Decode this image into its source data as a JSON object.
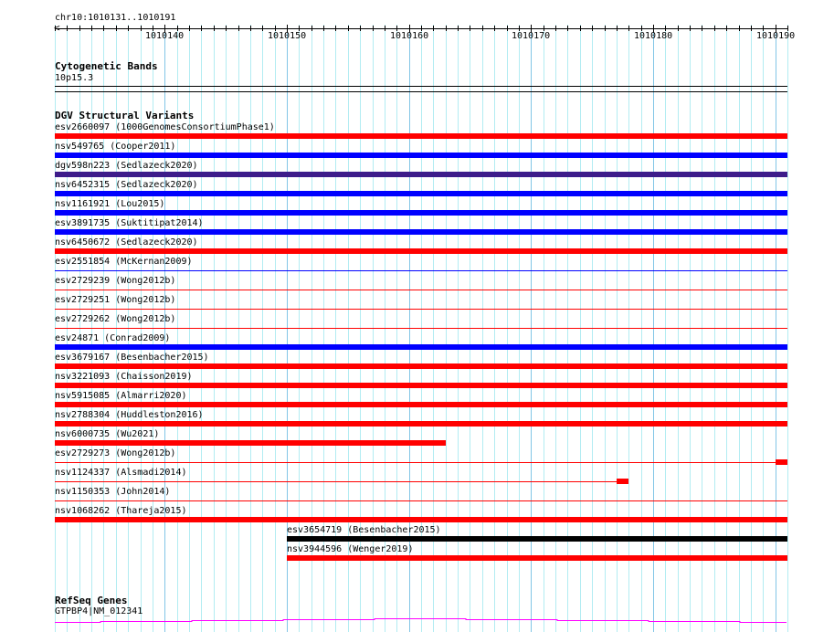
{
  "ruler": {
    "location": "chr10:1010131..1010191",
    "start": 1010131,
    "end": 1010191,
    "tick_labels": [
      "1010140",
      "1010150",
      "1010160",
      "1010170",
      "1010180",
      "1010190"
    ]
  },
  "cytoband": {
    "title": "Cytogenetic Bands",
    "band": "10p15.3"
  },
  "dgv": {
    "title": "DGV Structural Variants",
    "colors": {
      "red": "#ff0000",
      "blue": "#0000ff",
      "purple": "#3d1c8a",
      "black": "#000000"
    },
    "rows": [
      {
        "label": "esv2660097 (1000GenomesConsortiumPhase1)",
        "color": "#ff0000",
        "style": "bar",
        "start": 1010131,
        "end": 1010191
      },
      {
        "label": "nsv549765 (Cooper2011)",
        "color": "#0000ff",
        "style": "bar",
        "start": 1010131,
        "end": 1010191
      },
      {
        "label": "dgv598n223 (Sedlazeck2020)",
        "color": "#3d1c8a",
        "style": "bar",
        "start": 1010131,
        "end": 1010191
      },
      {
        "label": "nsv6452315 (Sedlazeck2020)",
        "color": "#0000ff",
        "style": "bar",
        "start": 1010131,
        "end": 1010191
      },
      {
        "label": "nsv1161921 (Lou2015)",
        "color": "#0000ff",
        "style": "bar",
        "start": 1010131,
        "end": 1010191
      },
      {
        "label": "esv3891735 (Suktitipat2014)",
        "color": "#0000ff",
        "style": "bar",
        "start": 1010131,
        "end": 1010191
      },
      {
        "label": "nsv6450672 (Sedlazeck2020)",
        "color": "#ff0000",
        "style": "bar",
        "start": 1010131,
        "end": 1010191
      },
      {
        "label": "esv2551854 (McKernan2009)",
        "color": "#0000ff",
        "style": "line",
        "start": 1010131,
        "end": 1010191
      },
      {
        "label": "esv2729239 (Wong2012b)",
        "color": "#ff0000",
        "style": "line",
        "start": 1010131,
        "end": 1010191
      },
      {
        "label": "esv2729251 (Wong2012b)",
        "color": "#ff0000",
        "style": "line",
        "start": 1010131,
        "end": 1010191
      },
      {
        "label": "esv2729262 (Wong2012b)",
        "color": "#ff0000",
        "style": "line",
        "start": 1010131,
        "end": 1010191
      },
      {
        "label": "esv24871 (Conrad2009)",
        "color": "#0000ff",
        "style": "bar",
        "start": 1010131,
        "end": 1010191
      },
      {
        "label": "esv3679167 (Besenbacher2015)",
        "color": "#ff0000",
        "style": "bar",
        "start": 1010131,
        "end": 1010191
      },
      {
        "label": "nsv3221093 (Chaisson2019)",
        "color": "#ff0000",
        "style": "bar",
        "start": 1010131,
        "end": 1010191
      },
      {
        "label": "nsv5915085 (Almarri2020)",
        "color": "#ff0000",
        "style": "bar",
        "start": 1010131,
        "end": 1010191
      },
      {
        "label": "nsv2788304 (Huddleston2016)",
        "color": "#ff0000",
        "style": "bar",
        "start": 1010131,
        "end": 1010191
      },
      {
        "label": "nsv6000735 (Wu2021)",
        "color": "#ff0000",
        "style": "bar",
        "start": 1010131,
        "end": 1010163
      },
      {
        "label": "esv2729273 (Wong2012b)",
        "color": "#ff0000",
        "style": "line",
        "start": 1010131,
        "end": 1010190,
        "block": [
          1010190,
          1010191
        ]
      },
      {
        "label": "nsv1124337 (Alsmadi2014)",
        "color": "#ff0000",
        "style": "line",
        "start": 1010131,
        "end": 1010177,
        "block": [
          1010177,
          1010178
        ]
      },
      {
        "label": "nsv1150353 (John2014)",
        "color": "#ff0000",
        "style": "line",
        "start": 1010131,
        "end": 1010191
      },
      {
        "label": "nsv1068262 (Thareja2015)",
        "color": "#ff0000",
        "style": "bar",
        "start": 1010131,
        "end": 1010191
      },
      {
        "label": "esv3654719 (Besenbacher2015)",
        "color": "#000000",
        "style": "bar",
        "start": 1010150,
        "end": 1010191
      },
      {
        "label": "nsv3944596 (Wenger2019)",
        "color": "#ff0000",
        "style": "bar",
        "start": 1010150,
        "end": 1010191
      }
    ]
  },
  "refseq": {
    "title": "RefSeq Genes",
    "gene": "GTPBP4|NM_012341",
    "color": "#ff00ff"
  }
}
